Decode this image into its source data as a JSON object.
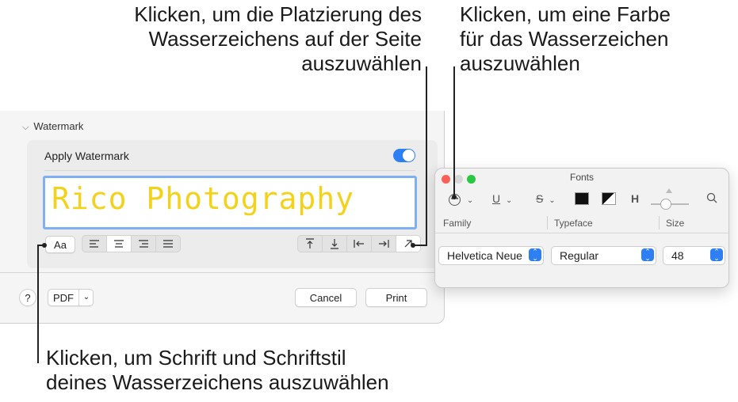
{
  "callouts": {
    "placement": "Klicken, um die Platzierung des\nWasserzeichens auf der Seite\nauszuwählen",
    "color": "Klicken, um eine Farbe\nfür das Wasserzeichen\nauszuwählen",
    "font": "Klicken, um Schrift und Schriftstil\ndeines Wasserzeichens auszuwählen"
  },
  "watermark": {
    "section_label": "Watermark",
    "apply_label": "Apply Watermark",
    "apply_enabled": true,
    "text": "Rico Photography",
    "text_color": "#f2d21b",
    "font_button": "Aa",
    "align_icons": [
      "align-left-icon",
      "align-center-icon",
      "align-right-icon",
      "align-justify-icon"
    ],
    "selected_align": "center",
    "position_icons": [
      "arrow-up-icon",
      "arrow-down-icon",
      "arrow-left-icon",
      "arrow-right-icon",
      "arrow-diagonal-icon"
    ],
    "selected_position": "diagonal"
  },
  "footer": {
    "help": "?",
    "pdf": "PDF",
    "cancel": "Cancel",
    "print": "Print"
  },
  "fonts_panel": {
    "title": "Fonts",
    "toolbar": {
      "underline": "U",
      "strike": "S",
      "spacing": "H"
    },
    "columns": {
      "family": "Family",
      "typeface": "Typeface",
      "size": "Size"
    },
    "family_value": "Helvetica Neue",
    "typeface_value": "Regular",
    "size_value": "48"
  },
  "colors": {
    "accent": "#2f7ff4",
    "close": "#fe5f57",
    "minimize": "#d7d7d7",
    "zoom": "#28c840"
  }
}
